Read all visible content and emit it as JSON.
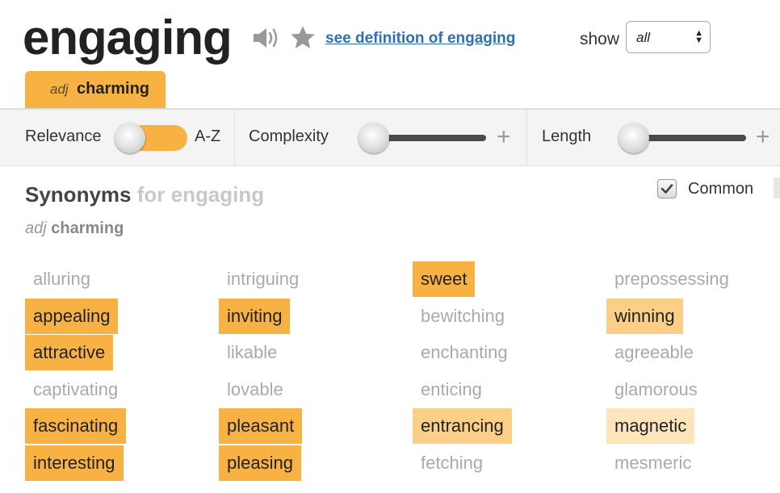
{
  "header": {
    "word": "engaging",
    "definition_link": "see definition of engaging",
    "show_label": "show",
    "show_value": "all",
    "speaker_icon": "speaker-icon",
    "star_icon": "star-icon"
  },
  "sense_tab": {
    "pos": "adj",
    "definition": "charming"
  },
  "filters": {
    "relevance": "Relevance",
    "az": "A-Z",
    "complexity": "Complexity",
    "length": "Length",
    "plus": "+",
    "complexity_level": 0,
    "length_level": 0
  },
  "synonyms_section": {
    "title": "Synonyms",
    "title_for": "for engaging",
    "common_label": "Common",
    "common_checked": true,
    "pos": "adj",
    "definition": "charming"
  },
  "synonym_columns": [
    [
      {
        "word": "alluring",
        "relevance": 0
      },
      {
        "word": "appealing",
        "relevance": 3
      },
      {
        "word": "attractive",
        "relevance": 3
      },
      {
        "word": "captivating",
        "relevance": 0
      },
      {
        "word": "fascinating",
        "relevance": 3
      },
      {
        "word": "interesting",
        "relevance": 3
      }
    ],
    [
      {
        "word": "intriguing",
        "relevance": 0
      },
      {
        "word": "inviting",
        "relevance": 3
      },
      {
        "word": "likable",
        "relevance": 0
      },
      {
        "word": "lovable",
        "relevance": 0
      },
      {
        "word": "pleasant",
        "relevance": 3
      },
      {
        "word": "pleasing",
        "relevance": 3
      }
    ],
    [
      {
        "word": "sweet",
        "relevance": 3
      },
      {
        "word": "bewitching",
        "relevance": 0
      },
      {
        "word": "enchanting",
        "relevance": 0
      },
      {
        "word": "enticing",
        "relevance": 0
      },
      {
        "word": "entrancing",
        "relevance": 2
      },
      {
        "word": "fetching",
        "relevance": 0
      }
    ],
    [
      {
        "word": "prepossessing",
        "relevance": 0
      },
      {
        "word": "winning",
        "relevance": 2
      },
      {
        "word": "agreeable",
        "relevance": 0
      },
      {
        "word": "glamorous",
        "relevance": 0
      },
      {
        "word": "magnetic",
        "relevance": 1
      },
      {
        "word": "mesmeric",
        "relevance": 0
      }
    ]
  ],
  "colors": {
    "accent": "#f8b244",
    "relevance_3": "#f8b244",
    "relevance_2": "#fbcf86",
    "relevance_1": "#fde4bb",
    "link": "#2f6fb3"
  }
}
